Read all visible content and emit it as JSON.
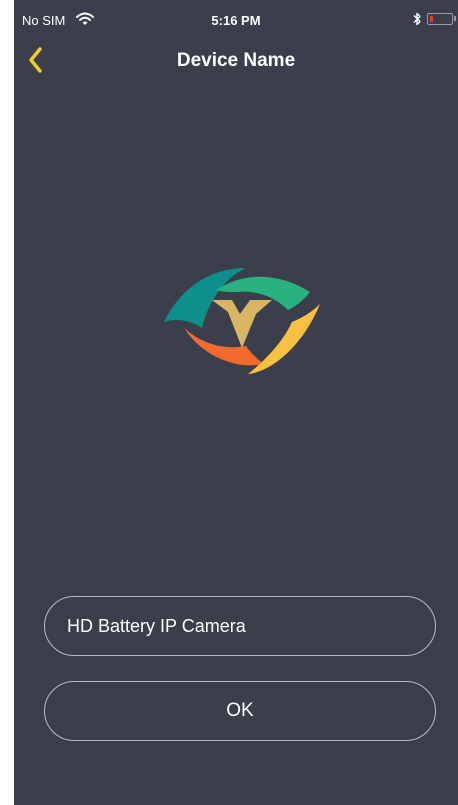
{
  "status_bar": {
    "carrier": "No SIM",
    "time": "5:16 PM",
    "wifi_icon": "wifi-icon",
    "bluetooth_icon": "bluetooth-icon",
    "battery_icon": "battery-icon",
    "battery_level": 0.1,
    "battery_color": "#e53935"
  },
  "nav": {
    "title": "Device Name",
    "back_icon": "chevron-left-icon",
    "back_color": "#f2cf1c"
  },
  "logo": {
    "icon": "eye-v-logo"
  },
  "form": {
    "device_name_value": "HD Battery IP Camera",
    "ok_label": "OK"
  },
  "colors": {
    "background": "#3b3e4b",
    "accent": "#f2cf1c"
  }
}
